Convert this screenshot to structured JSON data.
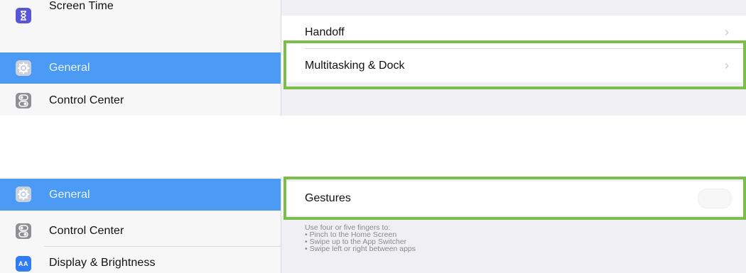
{
  "top": {
    "sidebar": [
      {
        "label": "Screen Time",
        "icon": "hourglass-icon"
      },
      {
        "label": "General",
        "icon": "gear-icon",
        "selected": true
      },
      {
        "label": "Control Center",
        "icon": "switches-icon"
      }
    ],
    "detail": [
      {
        "label": "Handoff"
      },
      {
        "label": "Multitasking & Dock"
      }
    ]
  },
  "bottom": {
    "sidebar": [
      {
        "label": "General",
        "icon": "gear-icon",
        "selected": true
      },
      {
        "label": "Control Center",
        "icon": "switches-icon"
      },
      {
        "label": "Display & Brightness",
        "icon": "display-brightness-icon",
        "icon_text": "AA"
      }
    ],
    "detail": [
      {
        "label": "Gestures"
      }
    ],
    "footer": {
      "intro": "Use four or five fingers to:",
      "items": [
        "• Pinch to the Home Screen",
        "• Swipe up to the App Switcher",
        "• Swipe left or right between apps"
      ]
    }
  },
  "colors": {
    "selection": "#4b9bf5",
    "highlight_border": "#7bbf4a",
    "detail_background": "#efeff4"
  }
}
